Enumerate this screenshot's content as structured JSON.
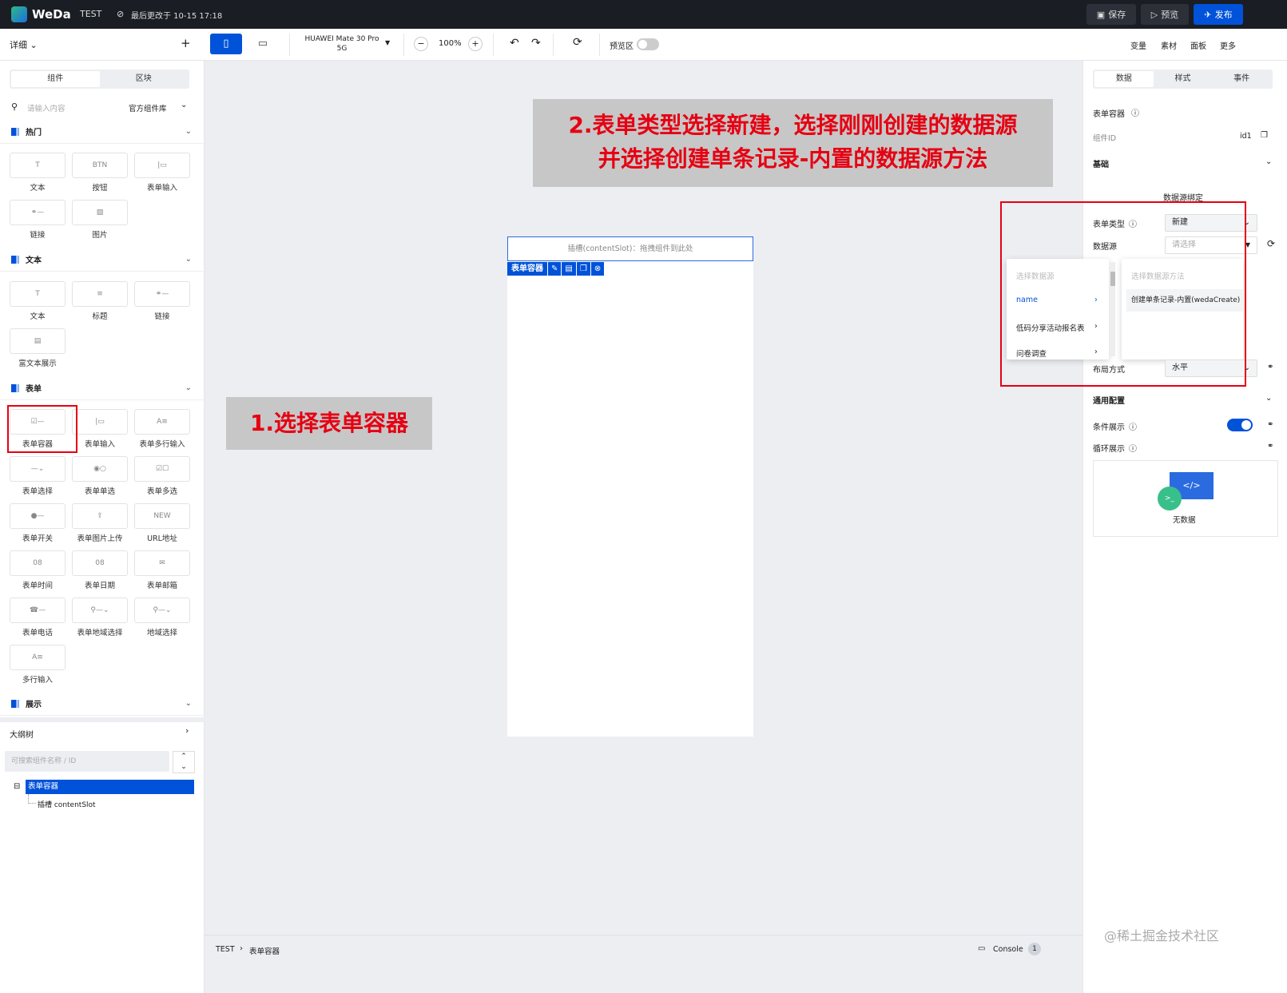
{
  "topbar": {
    "app_name": "WeDa",
    "project": "TEST",
    "last_saved": "最后更改于 10-15 17:18",
    "save": "保存",
    "preview": "预览",
    "publish": "发布"
  },
  "toolbar": {
    "detail": "详细",
    "add": "+",
    "device": "HUAWEI Mate 30 Pro 5G",
    "zoom": "100%",
    "preview_area": "预览区",
    "right": [
      "变量",
      "素材",
      "面板",
      "更多"
    ]
  },
  "left": {
    "tabs": [
      "组件",
      "区块"
    ],
    "search_placeholder": "请输入内容",
    "library": "官方组件库",
    "sections": {
      "hot": "热门",
      "text": "文本",
      "form": "表单",
      "display": "展示"
    },
    "hot_items": [
      "文本",
      "按钮",
      "表单输入",
      "链接",
      "图片"
    ],
    "text_items": [
      "文本",
      "标题",
      "链接",
      "富文本展示"
    ],
    "form_items": [
      "表单容器",
      "表单输入",
      "表单多行输入",
      "表单选择",
      "表单单选",
      "表单多选",
      "表单开关",
      "表单图片上传",
      "URL地址",
      "表单时间",
      "表单日期",
      "表单邮箱",
      "表单电话",
      "表单地域选择",
      "地域选择",
      "多行输入"
    ],
    "outline": "大纲树",
    "outline_search": "可搜索组件名称 / ID",
    "tree": {
      "root": "表单容器",
      "child": "插槽 contentSlot"
    }
  },
  "canvas": {
    "slot_text": "插槽(contentSlot)：拖拽组件到此处",
    "tag": "表单容器",
    "anno1": "1.选择表单容器",
    "anno2_line1": "2.表单类型选择新建，选择刚刚创建的数据源",
    "anno2_line2": "并选择创建单条记录-内置的数据源方法",
    "breadcrumb": [
      "TEST",
      "表单容器"
    ],
    "console": "Console",
    "console_count": "1",
    "watermark": "@稀土掘金技术社区"
  },
  "right": {
    "tabs": [
      "数据",
      "样式",
      "事件"
    ],
    "comp_title": "表单容器",
    "comp_id_label": "组件ID",
    "comp_id": "id1",
    "basic": "基础",
    "binding": "数据源绑定",
    "form_type_label": "表单类型",
    "form_type": "新建",
    "datasource_label": "数据源",
    "datasource_placeholder": "请选择",
    "dd_left_header": "选择数据源",
    "dd_left": [
      "name",
      "低码分享活动报名表",
      "问卷调查"
    ],
    "dd_right_header": "选择数据源方法",
    "dd_right": [
      "创建单条记录-内置(wedaCreate)"
    ],
    "layout_label": "布局方式",
    "layout": "水平",
    "general": "通用配置",
    "cond": "条件展示",
    "loop": "循环展示",
    "nodata": "无数据"
  },
  "colors": {
    "accent": "#0052d9",
    "annotation": "#e60012"
  }
}
